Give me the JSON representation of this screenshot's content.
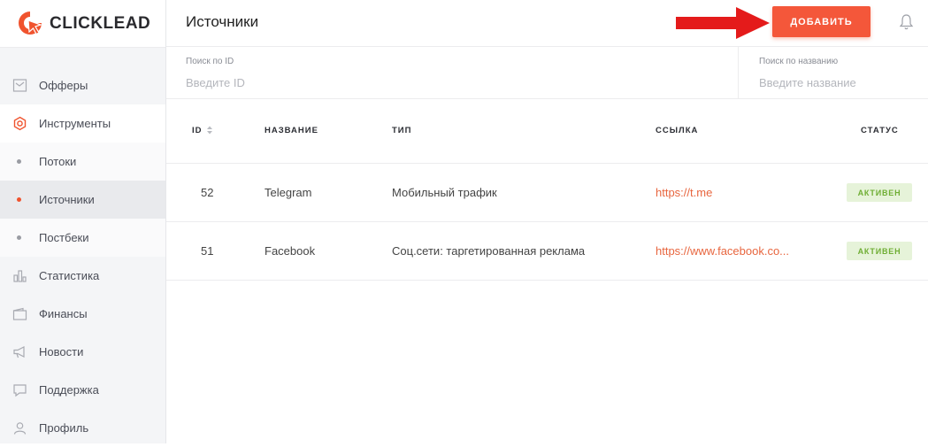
{
  "brand": {
    "name": "CLICKLEAD",
    "accent": "#f0532e"
  },
  "sidebar": {
    "items": [
      {
        "label": "Офферы",
        "icon": "offers-icon"
      },
      {
        "label": "Инструменты",
        "icon": "hexagon-tools-icon"
      },
      {
        "label": "Потоки",
        "sub": true
      },
      {
        "label": "Источники",
        "sub": true,
        "active": true
      },
      {
        "label": "Постбеки",
        "sub": true
      },
      {
        "label": "Статистика",
        "icon": "bar-chart-icon"
      },
      {
        "label": "Финансы",
        "icon": "wallet-icon"
      },
      {
        "label": "Новости",
        "icon": "megaphone-icon"
      },
      {
        "label": "Поддержка",
        "icon": "chat-icon"
      },
      {
        "label": "Профиль",
        "icon": "user-icon"
      }
    ]
  },
  "header": {
    "title": "Источники",
    "add_label": "ДОБАВИТЬ",
    "bell_icon": "bell-icon",
    "arrow_color": "#e41b1b"
  },
  "filters": {
    "id": {
      "label": "Поиск по ID",
      "placeholder": "Введите ID",
      "value": ""
    },
    "name": {
      "label": "Поиск по названию",
      "placeholder": "Введите название",
      "value": ""
    }
  },
  "table": {
    "columns": {
      "id": "ID",
      "name": "НАЗВАНИЕ",
      "type": "ТИП",
      "link": "ССЫЛКА",
      "status": "СТАТУС"
    },
    "rows": [
      {
        "id": "52",
        "name": "Telegram",
        "type": "Мобильный трафик",
        "link": "https://t.me",
        "status": "АКТИВЕН"
      },
      {
        "id": "51",
        "name": "Facebook",
        "type": "Соц.сети: таргетированная реклама",
        "link": "https://www.facebook.co...",
        "status": "АКТИВЕН"
      }
    ]
  }
}
